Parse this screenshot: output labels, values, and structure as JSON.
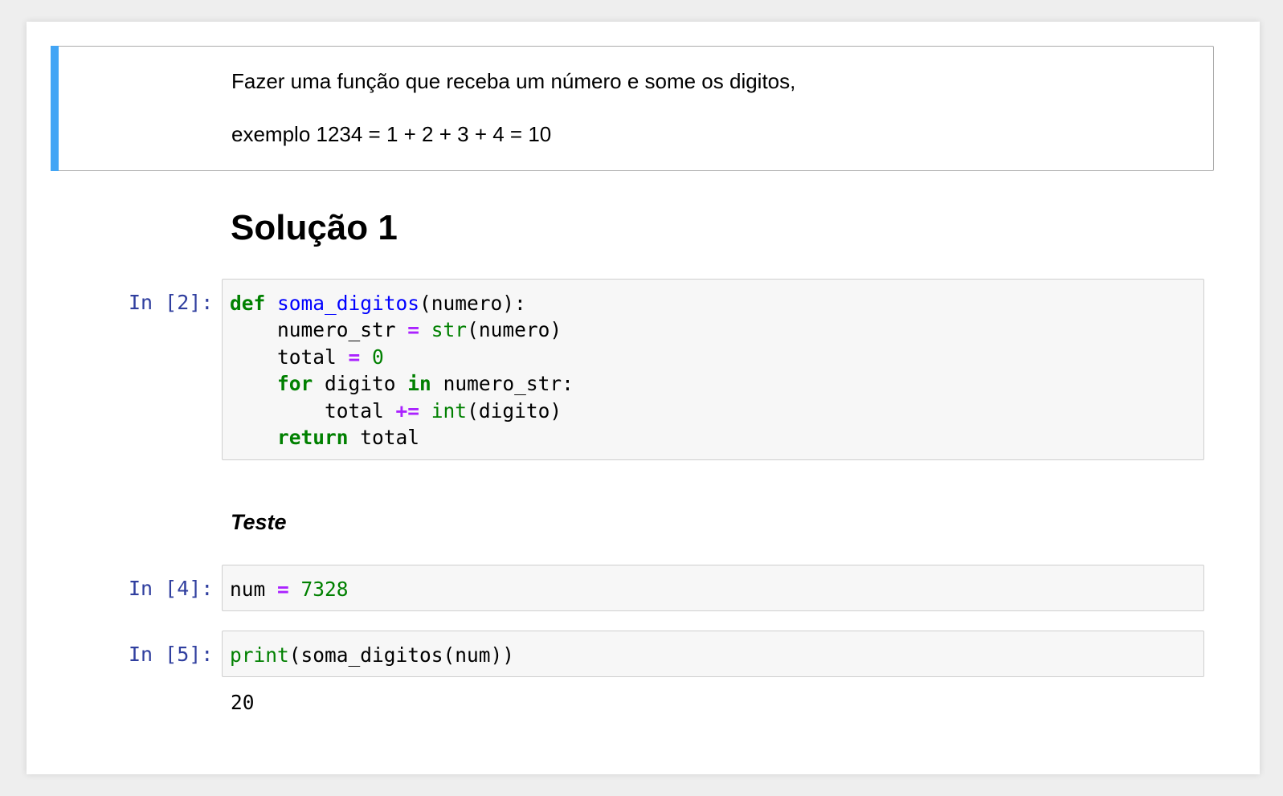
{
  "markdown_cell": {
    "line1": "Fazer uma função que receba um número e some os digitos,",
    "line2": "exemplo 1234 = 1 + 2 + 3 + 4 = 10"
  },
  "heading": "Solução 1",
  "cells": [
    {
      "prompt": "In [2]:",
      "code_lines": [
        "def soma_digitos(numero):",
        "    numero_str = str(numero)",
        "    total = 0",
        "    for digito in numero_str:",
        "        total += int(digito)",
        "    return total"
      ]
    },
    {
      "prompt": "In [4]:",
      "code_lines": [
        "num = 7328"
      ]
    },
    {
      "prompt": "In [5]:",
      "code_lines": [
        "print(soma_digitos(num))"
      ],
      "output": "20"
    }
  ],
  "subheading": "Teste",
  "colors": {
    "selection_bar": "#42a5f5",
    "prompt": "#303f9f",
    "keyword": "#008000",
    "function_name": "#0000ff",
    "operator": "#aa22ff",
    "code_background": "#f7f7f7"
  }
}
